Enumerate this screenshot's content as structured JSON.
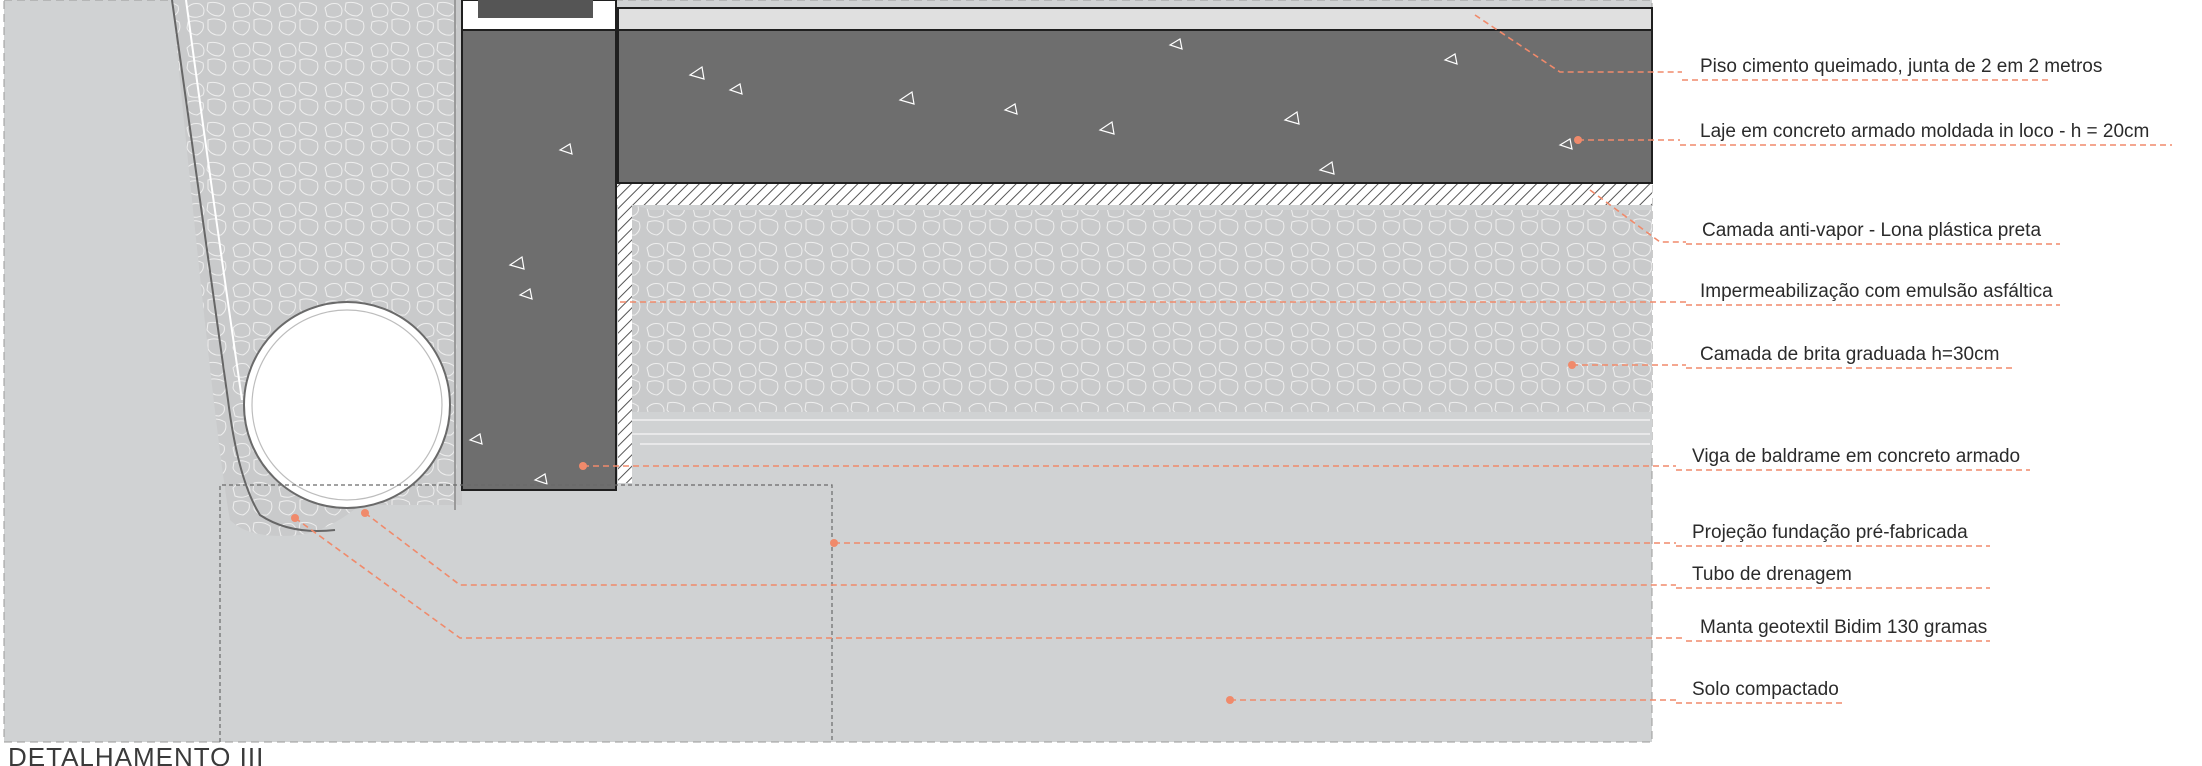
{
  "title": "DETALHAMENTO III",
  "colors": {
    "soil": "#d0d2d3",
    "gravel": "#c9cacb",
    "concrete": "#6e6e6e",
    "callout": "#f08a6b",
    "outline": "#1f1f1f"
  },
  "callouts": [
    {
      "id": "piso",
      "text": "Piso cimento queimado, junta de 2 em 2 metros"
    },
    {
      "id": "laje",
      "text": "Laje em concreto armado moldada in loco - h = 20cm"
    },
    {
      "id": "lona",
      "text": "Camada anti-vapor - Lona plástica preta"
    },
    {
      "id": "imperm",
      "text": "Impermeabilização com emulsão asfáltica"
    },
    {
      "id": "brita",
      "text": "Camada de brita graduada h=30cm"
    },
    {
      "id": "viga",
      "text": "Viga de baldrame em concreto armado"
    },
    {
      "id": "projecao",
      "text": "Projeção fundação pré-fabricada"
    },
    {
      "id": "tubo",
      "text": "Tubo de drenagem"
    },
    {
      "id": "manta",
      "text": "Manta geotextil Bidim 130 gramas"
    },
    {
      "id": "solo",
      "text": "Solo compactado"
    }
  ]
}
